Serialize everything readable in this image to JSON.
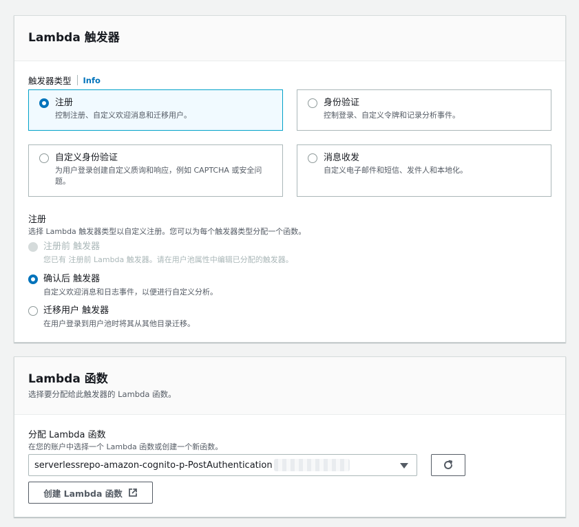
{
  "trigger_panel": {
    "title": "Lambda 触发器",
    "field_label": "触发器类型",
    "info": "Info",
    "tiles": [
      {
        "title": "注册",
        "desc": "控制注册、自定义欢迎消息和迁移用户。",
        "selected": true
      },
      {
        "title": "身份验证",
        "desc": "控制登录、自定义令牌和记录分析事件。",
        "selected": false
      },
      {
        "title": "自定义身份验证",
        "desc": "为用户登录创建自定义质询和响应，例如 CAPTCHA 或安全问题。",
        "selected": false
      },
      {
        "title": "消息收发",
        "desc": "自定义电子邮件和短信、发件人和本地化。",
        "selected": false
      }
    ],
    "signup_section": {
      "label": "注册",
      "desc": "选择 Lambda 触发器类型以自定义注册。您可以为每个触发器类型分配一个函数。",
      "options": [
        {
          "title": "注册前 触发器",
          "desc": "您已有 注册前 Lambda 触发器。请在用户池属性中编辑已分配的触发器。",
          "state": "disabled"
        },
        {
          "title": "确认后 触发器",
          "desc": "自定义欢迎消息和日志事件，以便进行自定义分析。",
          "state": "checked"
        },
        {
          "title": "迁移用户 触发器",
          "desc": "在用户登录到用户池时将其从其他目录迁移。",
          "state": "unchecked"
        }
      ]
    }
  },
  "function_panel": {
    "title": "Lambda 函数",
    "desc": "选择要分配给此触发器的 Lambda 函数。",
    "assign_label": "分配 Lambda 函数",
    "assign_desc": "在您的账户中选择一个 Lambda 函数或创建一个新函数。",
    "selected_function": "serverlessrepo-amazon-cognito-p-PostAuthentication",
    "create_button": "创建 Lambda 函数"
  },
  "colors": {
    "accent": "#0073bb",
    "selected_border": "#00a1c9",
    "selected_bg": "#f1faff"
  }
}
